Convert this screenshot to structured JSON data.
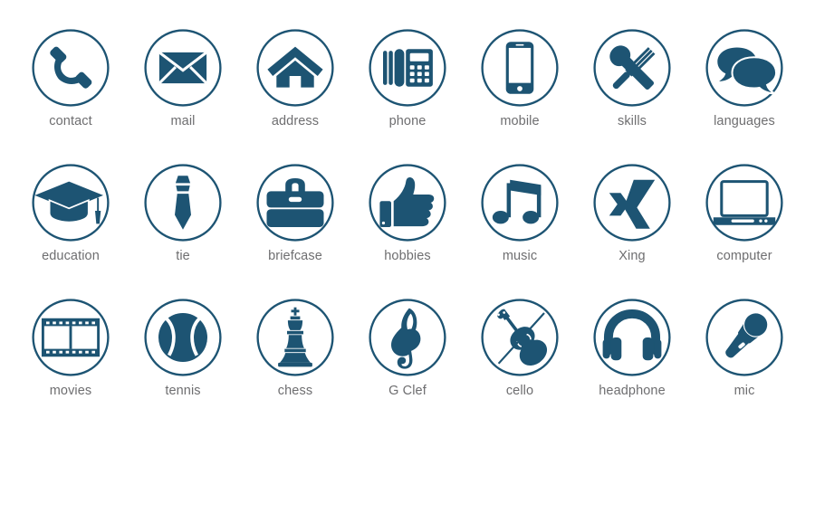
{
  "theme": {
    "background": "#ffffff",
    "icon_color": "#1d5473",
    "ring_color": "#1d5473",
    "label_color": "#6e6e70"
  },
  "grid": {
    "columns": 7,
    "rows": 3,
    "rows_data": [
      {
        "items": [
          {
            "label": "contact",
            "icon": "phone-handset-icon"
          },
          {
            "label": "mail",
            "icon": "envelope-icon"
          },
          {
            "label": "address",
            "icon": "house-icon"
          },
          {
            "label": "phone",
            "icon": "desk-phone-icon"
          },
          {
            "label": "mobile",
            "icon": "smartphone-icon"
          },
          {
            "label": "skills",
            "icon": "wrench-screwdriver-icon"
          },
          {
            "label": "languages",
            "icon": "speech-bubbles-icon"
          }
        ]
      },
      {
        "items": [
          {
            "label": "education",
            "icon": "graduation-cap-icon"
          },
          {
            "label": "tie",
            "icon": "necktie-icon"
          },
          {
            "label": "briefcase",
            "icon": "briefcase-icon"
          },
          {
            "label": "hobbies",
            "icon": "thumbs-up-icon"
          },
          {
            "label": "music",
            "icon": "music-note-icon"
          },
          {
            "label": "Xing",
            "icon": "xing-logo-icon"
          },
          {
            "label": "computer",
            "icon": "laptop-icon"
          }
        ]
      },
      {
        "items": [
          {
            "label": "movies",
            "icon": "film-strip-icon"
          },
          {
            "label": "tennis",
            "icon": "tennis-ball-icon"
          },
          {
            "label": "chess",
            "icon": "chess-king-icon"
          },
          {
            "label": "G Clef",
            "icon": "treble-clef-icon"
          },
          {
            "label": "cello",
            "icon": "cello-icon"
          },
          {
            "label": "headphone",
            "icon": "headphones-icon"
          },
          {
            "label": "mic",
            "icon": "microphone-icon"
          }
        ]
      }
    ]
  }
}
